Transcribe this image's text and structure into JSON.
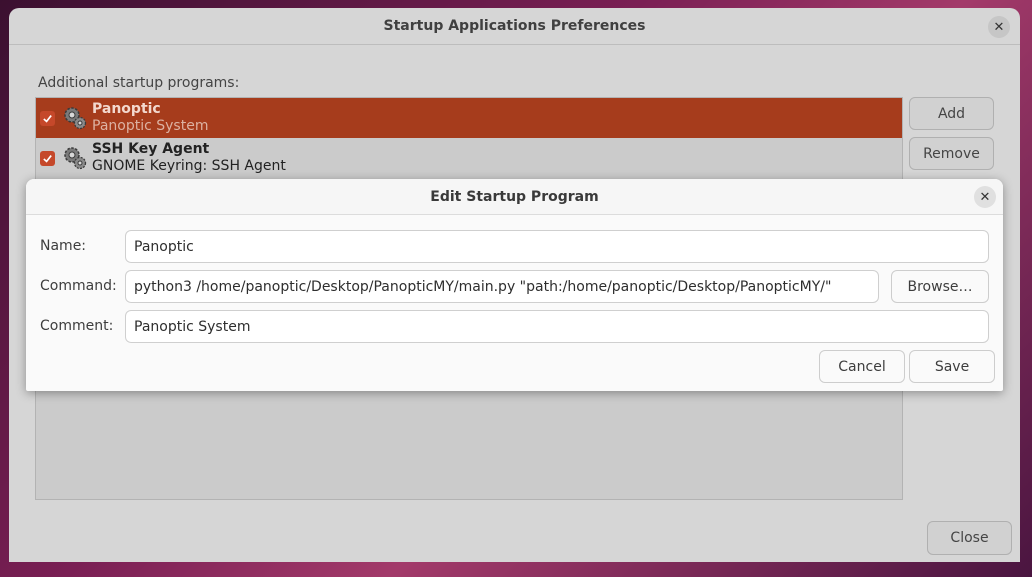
{
  "main_window": {
    "title": "Startup Applications Preferences",
    "section_label": "Additional startup programs:",
    "programs": [
      {
        "name": "Panoptic",
        "description": "Panoptic System",
        "enabled": true,
        "selected": true,
        "icon": "gear-icon"
      },
      {
        "name": "SSH Key Agent",
        "description": "GNOME Keyring: SSH Agent",
        "enabled": true,
        "selected": false,
        "icon": "gear-icon"
      }
    ],
    "add_label": "Add",
    "remove_label": "Remove",
    "close_label": "Close"
  },
  "dialog": {
    "title": "Edit Startup Program",
    "name_label": "Name:",
    "name_value": "Panoptic",
    "command_label": "Command:",
    "command_value": "python3 /home/panoptic/Desktop/PanopticMY/main.py \"path:/home/panoptic/Desktop/PanopticMY/\"",
    "browse_label": "Browse…",
    "comment_label": "Comment:",
    "comment_value": "Panoptic System",
    "cancel_label": "Cancel",
    "save_label": "Save"
  },
  "colors": {
    "selection": "#a63c1c",
    "checkbox": "#c5482a"
  }
}
